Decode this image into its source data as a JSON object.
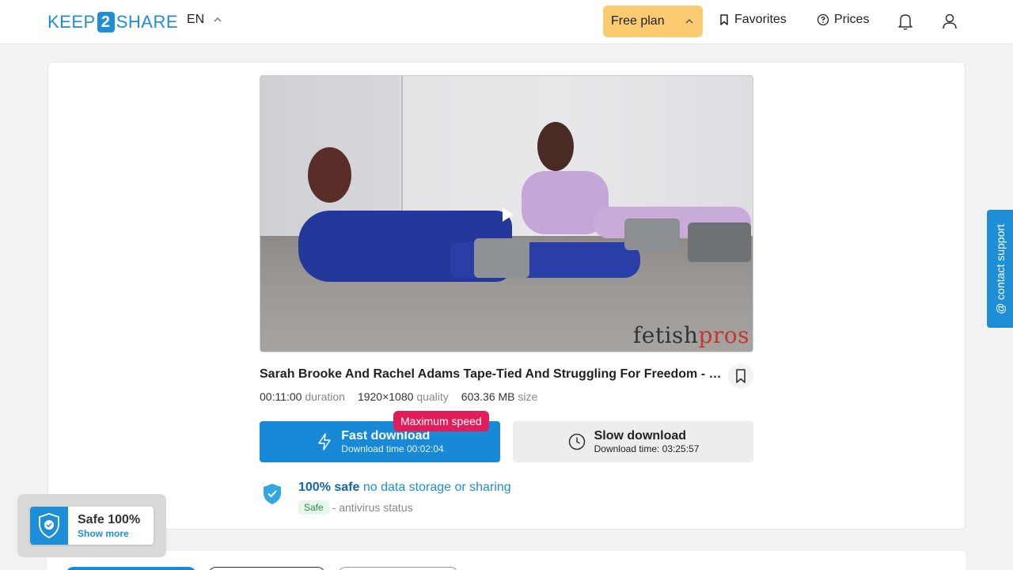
{
  "header": {
    "logo_left": "KEEP",
    "logo_mid": "2",
    "logo_right": "SHARE",
    "lang": "EN",
    "plan_label": "Free plan",
    "favorites_label": "Favorites",
    "prices_label": "Prices"
  },
  "video": {
    "watermark_a": "fetish",
    "watermark_b": "pros"
  },
  "file": {
    "title": "Sarah Brooke And Rachel Adams Tape-Tied And Struggling For Freedom - FetishPros",
    "duration": "00:11:00",
    "duration_label": "duration",
    "quality": "1920×1080",
    "quality_label": "quality",
    "size": "603.36 MB",
    "size_label": "size"
  },
  "download": {
    "badge": "Maximum speed",
    "fast_label": "Fast download",
    "fast_sub": "Download time 00:02:04",
    "slow_label": "Slow download",
    "slow_sub": "Download time: 03:25:57"
  },
  "safety": {
    "headline_bold": "100% safe",
    "headline_rest": "no data storage or sharing",
    "badge": "Safe",
    "status_text": "- antivirus status"
  },
  "support": {
    "label": "@ contact support"
  },
  "popup": {
    "title": "Safe 100%",
    "more": "Show more"
  },
  "colors": {
    "brand_blue": "#1789d6",
    "plan_yellow": "#fbcb72",
    "badge_red": "#e11d5a"
  }
}
